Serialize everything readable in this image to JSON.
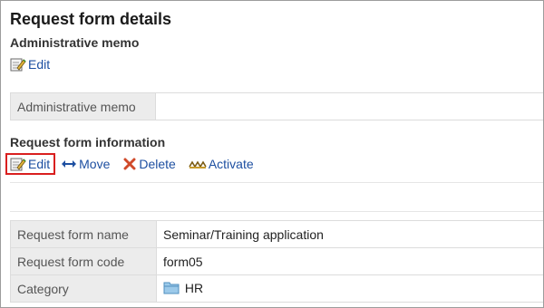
{
  "page_title": "Request form details",
  "admin_section": {
    "title": "Administrative memo",
    "edit_label": "Edit",
    "table": {
      "label": "Administrative memo",
      "value": ""
    }
  },
  "info_section": {
    "title": "Request form information",
    "actions": {
      "edit": "Edit",
      "move": "Move",
      "delete": "Delete",
      "activate": "Activate"
    },
    "rows": [
      {
        "label": "Request form name",
        "value": "Seminar/Training application"
      },
      {
        "label": "Request form code",
        "value": "form05"
      },
      {
        "label": "Category",
        "value": "HR",
        "icon": "folder-icon"
      }
    ]
  },
  "colors": {
    "link": "#1d4fa1",
    "highlight": "#d91f1f",
    "label_bg": "#ececec",
    "delete_icon": "#d04a2a"
  }
}
